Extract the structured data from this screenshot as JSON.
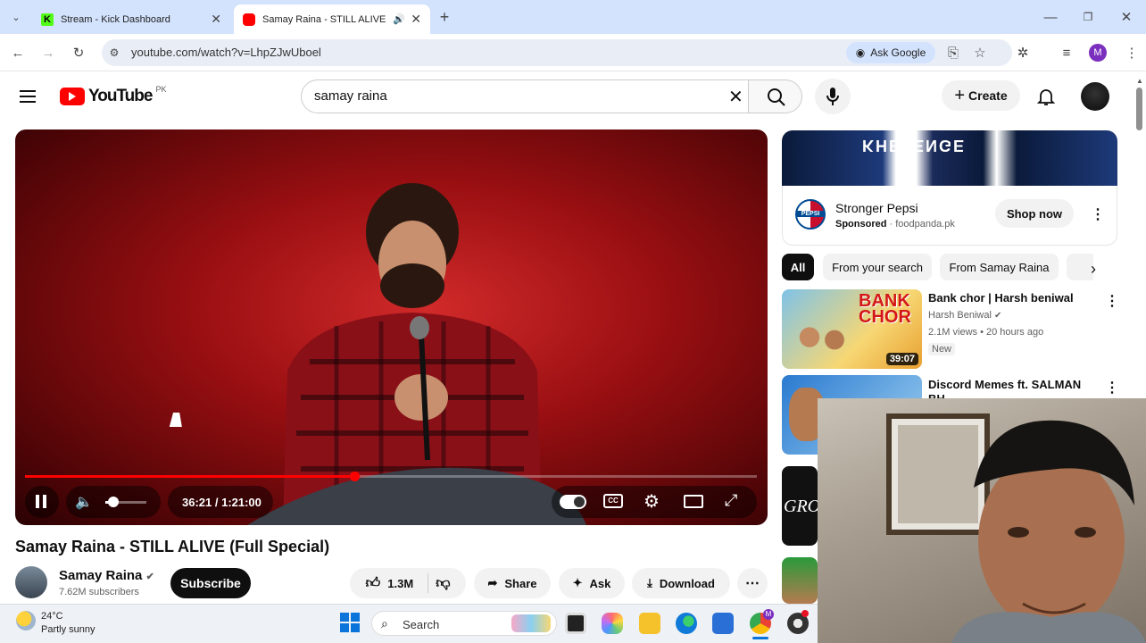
{
  "browser": {
    "tabs": [
      {
        "title": "Stream - Kick Dashboard"
      },
      {
        "title": "Samay Raina - STILL ALIVE ("
      }
    ],
    "url": "youtube.com/watch?v=LhpZJwUboel",
    "ask_google": "Ask Google",
    "profile_initial": "M"
  },
  "youtube": {
    "logo": "YouTube",
    "region": "PK",
    "search_value": "samay raina",
    "create_label": "Create"
  },
  "player": {
    "time": "36:21 / 1:21:00",
    "progress": 0.45,
    "volume": 0.2
  },
  "video": {
    "title": "Samay Raina - STILL ALIVE (Full Special)",
    "channel": "Samay Raina",
    "subscribers": "7.62M subscribers",
    "subscribe_label": "Subscribe",
    "likes": "1.3M",
    "share_label": "Share",
    "ask_label": "Ask",
    "download_label": "Download"
  },
  "ad": {
    "title": "Stronger Pepsi",
    "sponsored": "Sponsored",
    "domain": "foodpanda.pk",
    "cta": "Shop now",
    "banner_text": "KHELENGE",
    "logo_text": "PEPSI"
  },
  "chips": [
    "All",
    "From your search",
    "From Samay Raina"
  ],
  "recommendations": [
    {
      "title": "Bank chor | Harsh beniwal",
      "channel": "Harsh Beniwal",
      "meta": "2.1M views • 20 hours ago",
      "badge": "New",
      "duration": "39:07",
      "thumb_text": "BANK CHOR"
    },
    {
      "title": "Discord Memes ft. SALMAN",
      "title2": "BH..."
    }
  ],
  "rec3_thumb_text": "GRO",
  "taskbar": {
    "temp": "24°C",
    "condition": "Partly sunny",
    "search": "Search"
  }
}
